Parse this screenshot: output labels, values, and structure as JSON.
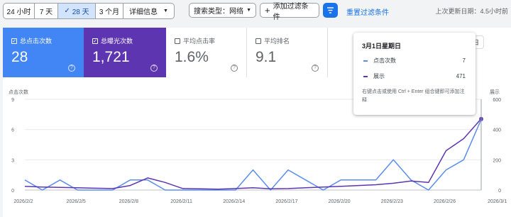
{
  "filters": {
    "ranges": [
      "24 小时",
      "7 天",
      "28 天",
      "3 个月"
    ],
    "selected_range": "28 天",
    "details_label": "详细信息",
    "search_type_label": "搜索类型：网络",
    "add_filter_label": "添加过滤条件",
    "reset_filter_label": "重置过滤条件",
    "last_updated": "上次更新日期：4.5小时前"
  },
  "cards": [
    {
      "label": "总点击次数",
      "value": "28",
      "checked": true,
      "bg": "#4285f4",
      "fg": "#ffffff"
    },
    {
      "label": "总曝光次数",
      "value": "1,721",
      "checked": true,
      "bg": "#5e35b1",
      "fg": "#ffffff"
    },
    {
      "label": "平均点击率",
      "value": "1.6%",
      "checked": false,
      "bg": "#ffffff",
      "fg": "#5f6368"
    },
    {
      "label": "平均排名",
      "value": "9.1",
      "checked": false,
      "bg": "#ffffff",
      "fg": "#5f6368"
    }
  ],
  "help_glyph": "?",
  "right_dropdown_label": "日",
  "tooltip": {
    "date": "3月1日星期日",
    "rows": [
      {
        "label": "点击次数",
        "value": "7"
      },
      {
        "label": "展示",
        "value": "471"
      }
    ],
    "hint": "右键点击或使用 Ctrl + Enter 组合键即可添加注释"
  },
  "colors": {
    "clicks": "#5b8def",
    "impressions": "#5e35b1",
    "accent": "#1a73e8"
  },
  "chart_data": {
    "type": "line",
    "ylabel_left": "点击次数",
    "ylabel_right": "展示",
    "yticks_left": [
      "9",
      "6",
      "3",
      "0"
    ],
    "yticks_right": [
      "600",
      "400",
      "200",
      "0"
    ],
    "ylim_left": [
      0,
      9
    ],
    "ylim_right": [
      0,
      600
    ],
    "xticks": [
      "2026/2/2",
      "2026/2/5",
      "2026/2/8",
      "2026/2/11",
      "2026/2/14",
      "2026/2/17",
      "2026/2/20",
      "2026/2/23",
      "2026/2/26",
      "2026/3/1"
    ],
    "series": [
      {
        "name": "点击次数",
        "axis": "left",
        "values": [
          1,
          0,
          1,
          0,
          0,
          0,
          1,
          1,
          0,
          0,
          0,
          0,
          0,
          2,
          0,
          2,
          1,
          0,
          1,
          1,
          1,
          3,
          1,
          0,
          2,
          3,
          7
        ]
      },
      {
        "name": "展示",
        "axis": "right",
        "values": [
          25,
          20,
          18,
          15,
          12,
          10,
          30,
          80,
          50,
          10,
          8,
          6,
          10,
          15,
          8,
          10,
          15,
          20,
          25,
          30,
          35,
          45,
          60,
          50,
          260,
          340,
          471
        ]
      }
    ]
  }
}
